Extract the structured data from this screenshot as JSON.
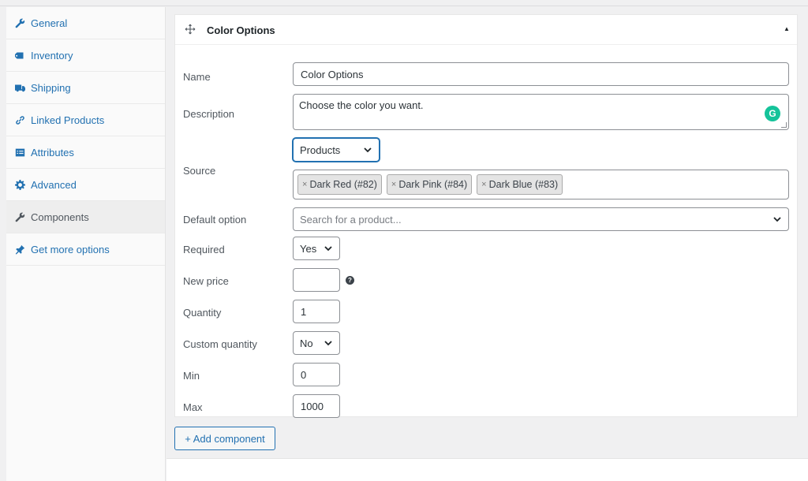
{
  "sidebar": {
    "items": [
      {
        "label": "General",
        "icon": "wrench-icon"
      },
      {
        "label": "Inventory",
        "icon": "tag-icon"
      },
      {
        "label": "Shipping",
        "icon": "truck-icon"
      },
      {
        "label": "Linked Products",
        "icon": "link-icon"
      },
      {
        "label": "Attributes",
        "icon": "list-icon"
      },
      {
        "label": "Advanced",
        "icon": "gear-icon"
      },
      {
        "label": "Components",
        "icon": "wrench-icon",
        "active": true
      },
      {
        "label": "Get more options",
        "icon": "plugin-icon"
      }
    ]
  },
  "component": {
    "title": "Color Options",
    "fields": {
      "name": {
        "label": "Name",
        "value": "Color Options"
      },
      "description": {
        "label": "Description",
        "value": "Choose the color you want."
      },
      "source": {
        "label": "Source",
        "selected": "Products",
        "tags": [
          "Dark Red (#82)",
          "Dark Pink (#84)",
          "Dark Blue (#83)"
        ]
      },
      "default_option": {
        "label": "Default option",
        "placeholder": "Search for a product..."
      },
      "required": {
        "label": "Required",
        "selected": "Yes"
      },
      "new_price": {
        "label": "New price",
        "value": ""
      },
      "quantity": {
        "label": "Quantity",
        "value": "1"
      },
      "custom_quantity": {
        "label": "Custom quantity",
        "selected": "No"
      },
      "min": {
        "label": "Min",
        "value": "0"
      },
      "max": {
        "label": "Max",
        "value": "1000"
      }
    }
  },
  "actions": {
    "add_component": "+ Add component"
  },
  "colors": {
    "accent": "#2271b1",
    "grammarly": "#15c39a"
  }
}
